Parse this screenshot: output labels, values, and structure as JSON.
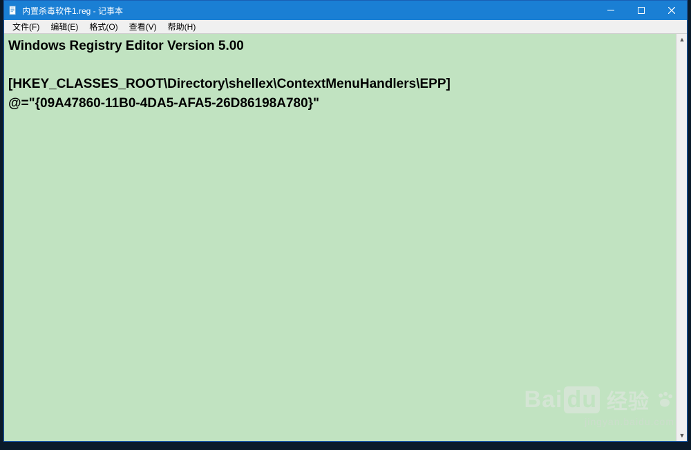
{
  "titlebar": {
    "title": "内置杀毒软件1.reg - 记事本"
  },
  "menubar": {
    "items": [
      "文件(F)",
      "编辑(E)",
      "格式(O)",
      "查看(V)",
      "帮助(H)"
    ]
  },
  "editor": {
    "content": "Windows Registry Editor Version 5.00\n\n[HKEY_CLASSES_ROOT\\Directory\\shellex\\ContextMenuHandlers\\EPP]\n@=\"{09A47860-11B0-4DA5-AFA5-26D86198A780}\""
  },
  "watermark": {
    "brand": "Bai",
    "brand2": "du",
    "label": "经验",
    "sub": "jingyan.baidu.com"
  }
}
